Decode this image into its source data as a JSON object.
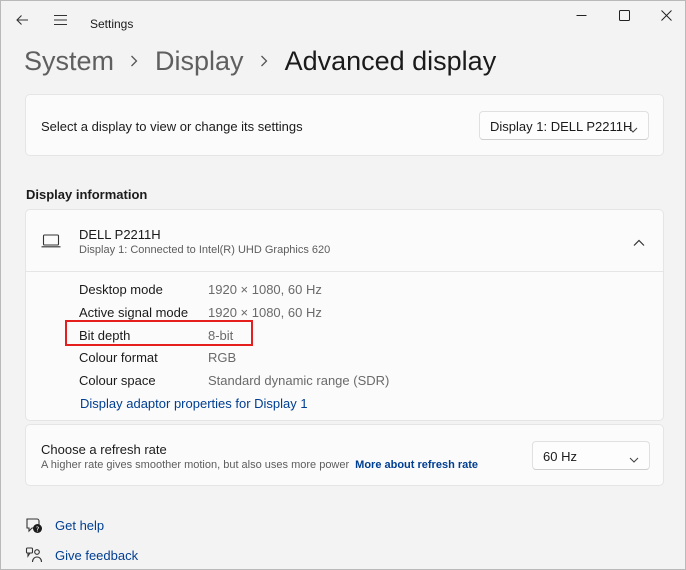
{
  "window": {
    "app_title": "Settings"
  },
  "breadcrumb": {
    "items": [
      "System",
      "Display",
      "Advanced display"
    ]
  },
  "display_select": {
    "label": "Select a display to view or change its settings",
    "selected": "Display 1: DELL P2211H"
  },
  "display_info": {
    "section_title": "Display information",
    "monitor_name": "DELL P2211H",
    "monitor_subtitle": "Display 1: Connected to Intel(R) UHD Graphics 620",
    "properties": [
      {
        "label": "Desktop mode",
        "value": "1920 × 1080, 60 Hz"
      },
      {
        "label": "Active signal mode",
        "value": "1920 × 1080, 60 Hz"
      },
      {
        "label": "Bit depth",
        "value": "8-bit"
      },
      {
        "label": "Colour format",
        "value": "RGB"
      },
      {
        "label": "Colour space",
        "value": "Standard dynamic range (SDR)"
      }
    ],
    "adapter_link": "Display adaptor properties for Display 1"
  },
  "refresh_rate": {
    "title": "Choose a refresh rate",
    "description": "A higher rate gives smoother motion, but also uses more power",
    "more_link": "More about refresh rate",
    "selected": "60 Hz"
  },
  "footer": {
    "get_help": "Get help",
    "give_feedback": "Give feedback"
  },
  "colors": {
    "accent_link": "#003e92",
    "highlight_border": "#e51e1e",
    "background": "#f3f3f3",
    "card": "#fbfbfb"
  },
  "icons": {
    "back": "back-arrow-icon",
    "menu": "hamburger-menu-icon",
    "monitor": "monitor-icon",
    "collapse": "chevron-up-icon",
    "dropdown": "chevron-down-icon",
    "help": "help-icon",
    "feedback": "feedback-icon"
  }
}
